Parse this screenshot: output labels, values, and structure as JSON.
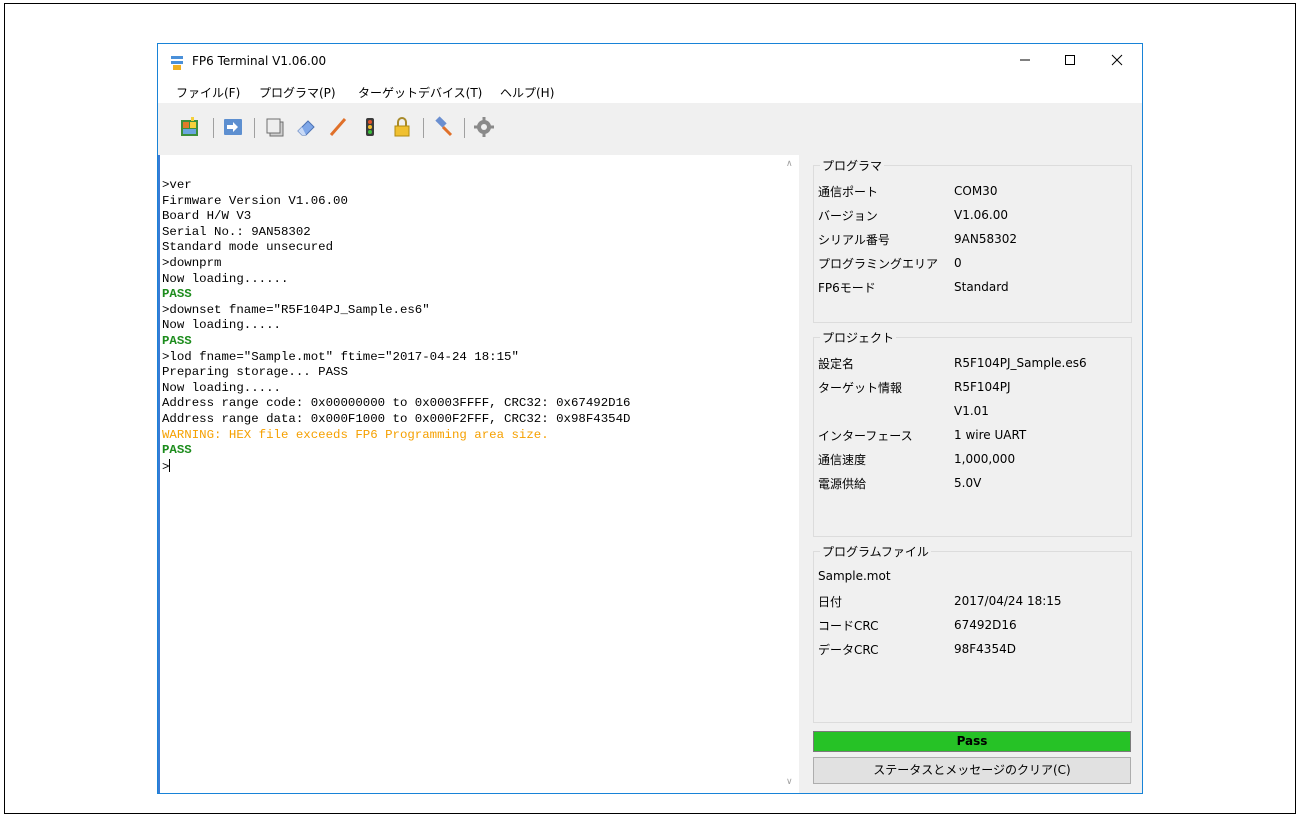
{
  "window": {
    "title": "FP6 Terminal V1.06.00"
  },
  "menu": [
    {
      "label": "ファイル(F)"
    },
    {
      "label": "プログラマ(P)"
    },
    {
      "label": "ターゲットデバイス(T)"
    },
    {
      "label": "ヘルプ(H)"
    }
  ],
  "toolbar": {
    "icons": [
      "project-setup-icon",
      "exchange-icon",
      "copy-icon",
      "erase-icon",
      "write-icon",
      "signal-icon",
      "lock-icon",
      "hammer-icon",
      "gear-icon"
    ]
  },
  "terminal": {
    "lines": [
      {
        "text": ">ver",
        "kind": "normal"
      },
      {
        "text": "Firmware Version V1.06.00",
        "kind": "normal"
      },
      {
        "text": "Board H/W V3",
        "kind": "normal"
      },
      {
        "text": "Serial No.: 9AN58302",
        "kind": "normal"
      },
      {
        "text": "Standard mode unsecured",
        "kind": "normal"
      },
      {
        "text": ">downprm",
        "kind": "normal"
      },
      {
        "text": "Now loading......",
        "kind": "normal"
      },
      {
        "text": "PASS",
        "kind": "pass"
      },
      {
        "text": ">downset fname=\"R5F104PJ_Sample.es6\"",
        "kind": "normal"
      },
      {
        "text": "Now loading.....",
        "kind": "normal"
      },
      {
        "text": "PASS",
        "kind": "pass"
      },
      {
        "text": ">lod fname=\"Sample.mot\" ftime=\"2017-04-24 18:15\"",
        "kind": "normal"
      },
      {
        "text": "Preparing storage... PASS",
        "kind": "normal"
      },
      {
        "text": "Now loading.....",
        "kind": "normal"
      },
      {
        "text": "Address range code: 0x00000000 to 0x0003FFFF, CRC32: 0x67492D16",
        "kind": "normal"
      },
      {
        "text": "Address range data: 0x000F1000 to 0x000F2FFF, CRC32: 0x98F4354D",
        "kind": "normal"
      },
      {
        "text": "WARNING: HEX file exceeds FP6 Programming area size.",
        "kind": "warn"
      },
      {
        "text": "PASS",
        "kind": "pass"
      }
    ],
    "prompt": ">"
  },
  "programmer": {
    "title": "プログラマ",
    "rows": [
      {
        "label": "通信ポート",
        "value": "COM30"
      },
      {
        "label": "バージョン",
        "value": "V1.06.00"
      },
      {
        "label": "シリアル番号",
        "value": "9AN58302"
      },
      {
        "label": "プログラミングエリア",
        "value": "0"
      },
      {
        "label": "FP6モード",
        "value": "Standard"
      }
    ]
  },
  "project": {
    "title": "プロジェクト",
    "settings_label": "設定名",
    "settings_value": "R5F104PJ_Sample.es6",
    "target_label": "ターゲット情報",
    "target_value": "R5F104PJ",
    "target_version": "V1.01",
    "interface_label": "インターフェース",
    "interface_value": "1 wire UART",
    "speed_label": "通信速度",
    "speed_value": "1,000,000",
    "power_label": "電源供給",
    "power_value": "5.0V"
  },
  "program_file": {
    "title": "プログラムファイル",
    "filename": "Sample.mot",
    "date_label": "日付",
    "date_value": "2017/04/24 18:15",
    "code_crc_label": "コードCRC",
    "code_crc_value": "67492D16",
    "data_crc_label": "データCRC",
    "data_crc_value": "98F4354D"
  },
  "status": {
    "text": "Pass",
    "color": "#26c226"
  },
  "clear_button": {
    "label": "ステータスとメッセージのクリア(C)"
  }
}
